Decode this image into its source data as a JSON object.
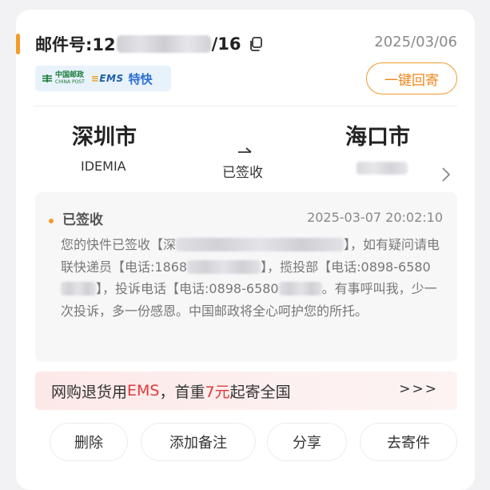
{
  "header": {
    "mail_no_prefix": "邮件号:12",
    "mail_no_suffix": "/16",
    "date": "2025/03/06"
  },
  "badge": {
    "cp_cn": "中国邮政",
    "cp_en": "CHINA POST",
    "ems": "EMS",
    "service": "特快"
  },
  "reply_button": "一键回寄",
  "route": {
    "from_city": "深圳市",
    "from_code": "IDEMIA",
    "status": "已签收",
    "to_city": "海口市"
  },
  "tracking": {
    "status": "已签收",
    "time": "2025-03-07 20:02:10",
    "text_1": "您的快件已签收【深",
    "text_2": "】，如有疑问请电联快递员【电话:1868",
    "text_3": "】，揽投部【电话:0898-6580",
    "text_4": "】，投诉电话【电话:0898-6580",
    "text_5": "。有事呼叫我，少一次投诉，多一份感恩。中国邮政将全心呵护您的所托。"
  },
  "promo": {
    "part_1": "网购退货用",
    "ems": "EMS",
    "part_2": "，首重",
    "price": "7元",
    "part_3": "起寄全国",
    "arrow": ">>>"
  },
  "actions": [
    "删除",
    "添加备注",
    "分享",
    "去寄件"
  ],
  "colors": {
    "accent_orange": "#f39a2b",
    "promo_red": "#e03b3b",
    "ems_blue": "#1f5fa8"
  }
}
